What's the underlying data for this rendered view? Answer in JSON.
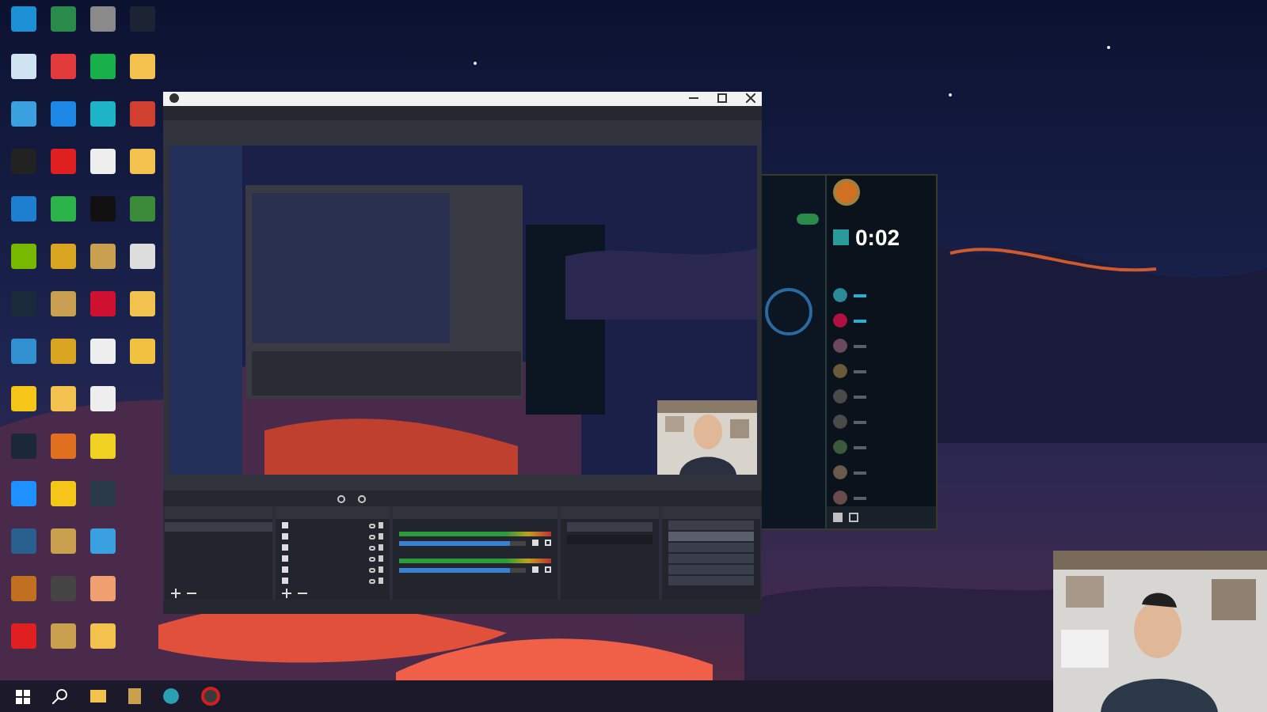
{
  "desktop": {
    "icon_rows": [
      [
        {
          "color": "#1e90d6"
        },
        {
          "color": "#2a8a4a"
        },
        {
          "color": "#8a8a8a"
        },
        {
          "color": "#1c2433"
        }
      ],
      [
        {
          "color": "#cfe3f0"
        },
        {
          "color": "#e33b3b"
        },
        {
          "color": "#18b04a"
        },
        {
          "color": "#f2c14e"
        }
      ],
      [
        {
          "color": "#3aa0e0"
        },
        {
          "color": "#1e88e5"
        },
        {
          "color": "#1eb4c8"
        },
        {
          "color": "#d04030"
        }
      ],
      [
        {
          "color": "#222222"
        },
        {
          "color": "#e02020"
        },
        {
          "color": "#eeeeee"
        },
        {
          "color": "#f2c14e"
        }
      ],
      [
        {
          "color": "#1e7fd0"
        },
        {
          "color": "#2cb34a"
        },
        {
          "color": "#111111"
        },
        {
          "color": "#3a8a3a"
        }
      ],
      [
        {
          "color": "#76b900"
        },
        {
          "color": "#d9a520"
        },
        {
          "color": "#c8a050"
        },
        {
          "color": "#dddddd"
        }
      ],
      [
        {
          "color": "#1a2a3a"
        },
        {
          "color": "#c8a050"
        },
        {
          "color": "#d01030"
        },
        {
          "color": "#f2c14e"
        }
      ],
      [
        {
          "color": "#3090d0"
        },
        {
          "color": "#d9a520"
        },
        {
          "color": "#eeeeee"
        },
        {
          "color": "#f0c040"
        }
      ],
      [
        {
          "color": "#f5c518"
        },
        {
          "color": "#f2c14e"
        },
        {
          "color": "#eeeeee"
        }
      ],
      [
        {
          "color": "#1b2838"
        },
        {
          "color": "#e07020"
        },
        {
          "color": "#f0d020"
        }
      ],
      [
        {
          "color": "#1e90ff"
        },
        {
          "color": "#f5c518"
        },
        {
          "color": "#2a3a4a"
        }
      ],
      [
        {
          "color": "#2a6090"
        },
        {
          "color": "#c8a050"
        },
        {
          "color": "#3aa0e0"
        }
      ],
      [
        {
          "color": "#c07020"
        },
        {
          "color": "#444444"
        },
        {
          "color": "#f0a070"
        }
      ],
      [
        {
          "color": "#e02020"
        },
        {
          "color": "#c8a050"
        },
        {
          "color": "#f2c14e"
        }
      ]
    ]
  },
  "obs_window": {
    "mixer": [
      {
        "level": 0.88
      },
      {
        "level": 0.88
      }
    ],
    "controls": [
      {
        "selected": false
      },
      {
        "selected": true
      },
      {
        "selected": false
      },
      {
        "selected": false
      },
      {
        "selected": false
      },
      {
        "selected": false
      }
    ]
  },
  "game_client": {
    "toggle": {
      "on": true
    },
    "timer": "0:02",
    "friends": [
      {
        "online": true,
        "color": "#2a8a9a"
      },
      {
        "online": true,
        "color": "#b01040"
      },
      {
        "online": false,
        "color": "#6a4a5a"
      },
      {
        "online": false,
        "color": "#6a5a3a"
      },
      {
        "online": false,
        "color": "#4a4a4a"
      },
      {
        "online": false,
        "color": "#4a4a4a"
      },
      {
        "online": false,
        "color": "#3a5a3a"
      },
      {
        "online": false,
        "color": "#6a5a4a"
      },
      {
        "online": false,
        "color": "#6a4a4a"
      }
    ]
  }
}
